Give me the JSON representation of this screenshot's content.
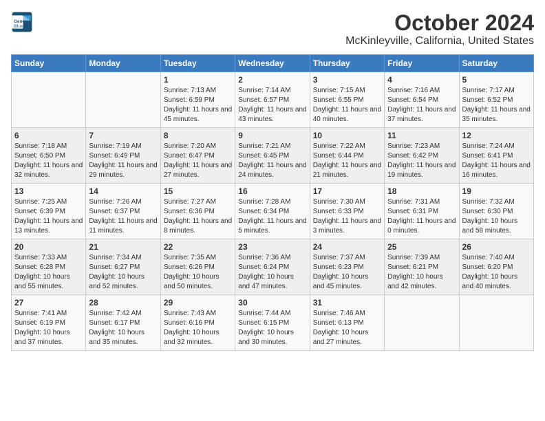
{
  "logo": {
    "line1": "General",
    "line2": "Blue"
  },
  "title": "October 2024",
  "subtitle": "McKinleyville, California, United States",
  "weekdays": [
    "Sunday",
    "Monday",
    "Tuesday",
    "Wednesday",
    "Thursday",
    "Friday",
    "Saturday"
  ],
  "weeks": [
    [
      {
        "day": "",
        "detail": ""
      },
      {
        "day": "",
        "detail": ""
      },
      {
        "day": "1",
        "detail": "Sunrise: 7:13 AM\nSunset: 6:59 PM\nDaylight: 11 hours and 45 minutes."
      },
      {
        "day": "2",
        "detail": "Sunrise: 7:14 AM\nSunset: 6:57 PM\nDaylight: 11 hours and 43 minutes."
      },
      {
        "day": "3",
        "detail": "Sunrise: 7:15 AM\nSunset: 6:55 PM\nDaylight: 11 hours and 40 minutes."
      },
      {
        "day": "4",
        "detail": "Sunrise: 7:16 AM\nSunset: 6:54 PM\nDaylight: 11 hours and 37 minutes."
      },
      {
        "day": "5",
        "detail": "Sunrise: 7:17 AM\nSunset: 6:52 PM\nDaylight: 11 hours and 35 minutes."
      }
    ],
    [
      {
        "day": "6",
        "detail": "Sunrise: 7:18 AM\nSunset: 6:50 PM\nDaylight: 11 hours and 32 minutes."
      },
      {
        "day": "7",
        "detail": "Sunrise: 7:19 AM\nSunset: 6:49 PM\nDaylight: 11 hours and 29 minutes."
      },
      {
        "day": "8",
        "detail": "Sunrise: 7:20 AM\nSunset: 6:47 PM\nDaylight: 11 hours and 27 minutes."
      },
      {
        "day": "9",
        "detail": "Sunrise: 7:21 AM\nSunset: 6:45 PM\nDaylight: 11 hours and 24 minutes."
      },
      {
        "day": "10",
        "detail": "Sunrise: 7:22 AM\nSunset: 6:44 PM\nDaylight: 11 hours and 21 minutes."
      },
      {
        "day": "11",
        "detail": "Sunrise: 7:23 AM\nSunset: 6:42 PM\nDaylight: 11 hours and 19 minutes."
      },
      {
        "day": "12",
        "detail": "Sunrise: 7:24 AM\nSunset: 6:41 PM\nDaylight: 11 hours and 16 minutes."
      }
    ],
    [
      {
        "day": "13",
        "detail": "Sunrise: 7:25 AM\nSunset: 6:39 PM\nDaylight: 11 hours and 13 minutes."
      },
      {
        "day": "14",
        "detail": "Sunrise: 7:26 AM\nSunset: 6:37 PM\nDaylight: 11 hours and 11 minutes."
      },
      {
        "day": "15",
        "detail": "Sunrise: 7:27 AM\nSunset: 6:36 PM\nDaylight: 11 hours and 8 minutes."
      },
      {
        "day": "16",
        "detail": "Sunrise: 7:28 AM\nSunset: 6:34 PM\nDaylight: 11 hours and 5 minutes."
      },
      {
        "day": "17",
        "detail": "Sunrise: 7:30 AM\nSunset: 6:33 PM\nDaylight: 11 hours and 3 minutes."
      },
      {
        "day": "18",
        "detail": "Sunrise: 7:31 AM\nSunset: 6:31 PM\nDaylight: 11 hours and 0 minutes."
      },
      {
        "day": "19",
        "detail": "Sunrise: 7:32 AM\nSunset: 6:30 PM\nDaylight: 10 hours and 58 minutes."
      }
    ],
    [
      {
        "day": "20",
        "detail": "Sunrise: 7:33 AM\nSunset: 6:28 PM\nDaylight: 10 hours and 55 minutes."
      },
      {
        "day": "21",
        "detail": "Sunrise: 7:34 AM\nSunset: 6:27 PM\nDaylight: 10 hours and 52 minutes."
      },
      {
        "day": "22",
        "detail": "Sunrise: 7:35 AM\nSunset: 6:26 PM\nDaylight: 10 hours and 50 minutes."
      },
      {
        "day": "23",
        "detail": "Sunrise: 7:36 AM\nSunset: 6:24 PM\nDaylight: 10 hours and 47 minutes."
      },
      {
        "day": "24",
        "detail": "Sunrise: 7:37 AM\nSunset: 6:23 PM\nDaylight: 10 hours and 45 minutes."
      },
      {
        "day": "25",
        "detail": "Sunrise: 7:39 AM\nSunset: 6:21 PM\nDaylight: 10 hours and 42 minutes."
      },
      {
        "day": "26",
        "detail": "Sunrise: 7:40 AM\nSunset: 6:20 PM\nDaylight: 10 hours and 40 minutes."
      }
    ],
    [
      {
        "day": "27",
        "detail": "Sunrise: 7:41 AM\nSunset: 6:19 PM\nDaylight: 10 hours and 37 minutes."
      },
      {
        "day": "28",
        "detail": "Sunrise: 7:42 AM\nSunset: 6:17 PM\nDaylight: 10 hours and 35 minutes."
      },
      {
        "day": "29",
        "detail": "Sunrise: 7:43 AM\nSunset: 6:16 PM\nDaylight: 10 hours and 32 minutes."
      },
      {
        "day": "30",
        "detail": "Sunrise: 7:44 AM\nSunset: 6:15 PM\nDaylight: 10 hours and 30 minutes."
      },
      {
        "day": "31",
        "detail": "Sunrise: 7:46 AM\nSunset: 6:13 PM\nDaylight: 10 hours and 27 minutes."
      },
      {
        "day": "",
        "detail": ""
      },
      {
        "day": "",
        "detail": ""
      }
    ]
  ]
}
